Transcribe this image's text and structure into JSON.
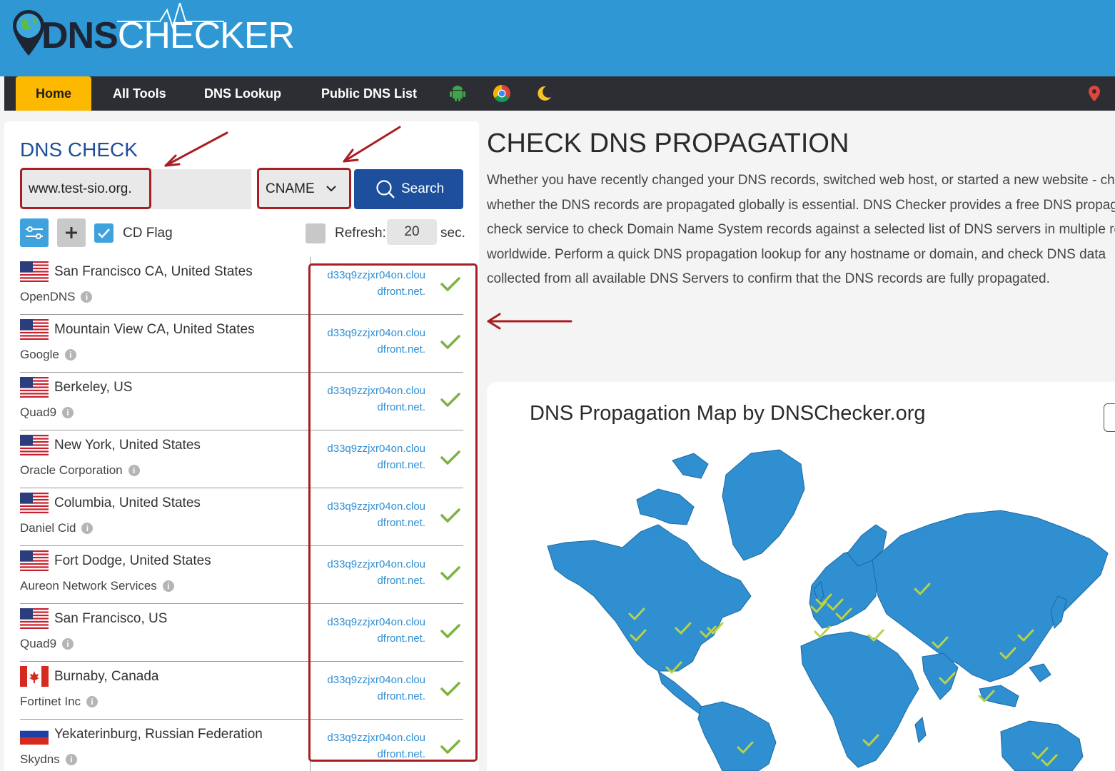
{
  "header": {
    "logo_text_a": "DNS",
    "logo_text_b": "CHECKER"
  },
  "nav": {
    "items": [
      {
        "label": "Home"
      },
      {
        "label": "All Tools"
      },
      {
        "label": "DNS Lookup"
      },
      {
        "label": "Public DNS List"
      }
    ],
    "icons": [
      "android-icon",
      "chrome-icon",
      "moon-icon",
      "location-pin-icon"
    ]
  },
  "dns_check": {
    "title": "DNS CHECK",
    "domain_value": "www.test-sio.org.",
    "record_type": "CNAME",
    "search_label": "Search",
    "cd_flag_label": "CD Flag",
    "cd_flag_checked": true,
    "refresh_label": "Refresh:",
    "refresh_value": "20",
    "refresh_unit": "sec.",
    "results": [
      {
        "location": "San Francisco CA, United States",
        "provider": "OpenDNS",
        "flag": "us",
        "result": [
          "d33q9zzjxr04on.clou",
          "dfront.net."
        ]
      },
      {
        "location": "Mountain View CA, United States",
        "provider": "Google",
        "flag": "us",
        "result": [
          "d33q9zzjxr04on.clou",
          "dfront.net."
        ]
      },
      {
        "location": "Berkeley, US",
        "provider": "Quad9",
        "flag": "us",
        "result": [
          "d33q9zzjxr04on.clou",
          "dfront.net."
        ]
      },
      {
        "location": "New York, United States",
        "provider": "Oracle Corporation",
        "flag": "us",
        "result": [
          "d33q9zzjxr04on.clou",
          "dfront.net."
        ]
      },
      {
        "location": "Columbia, United States",
        "provider": "Daniel Cid",
        "flag": "us",
        "result": [
          "d33q9zzjxr04on.clou",
          "dfront.net."
        ]
      },
      {
        "location": "Fort Dodge, United States",
        "provider": "Aureon Network Services",
        "flag": "us",
        "result": [
          "d33q9zzjxr04on.clou",
          "dfront.net."
        ]
      },
      {
        "location": "San Francisco, US",
        "provider": "Quad9",
        "flag": "us",
        "result": [
          "d33q9zzjxr04on.clou",
          "dfront.net."
        ]
      },
      {
        "location": "Burnaby, Canada",
        "provider": "Fortinet Inc",
        "flag": "ca",
        "result": [
          "d33q9zzjxr04on.clou",
          "dfront.net."
        ]
      },
      {
        "location": "Yekaterinburg, Russian Federation",
        "provider": "Skydns",
        "flag": "ru",
        "result": [
          "d33q9zzjxr04on.clou",
          "dfront.net."
        ]
      }
    ]
  },
  "main": {
    "title": "CHECK DNS PROPAGATION",
    "desc_lines": [
      "Whether you have recently changed your DNS records, switched web host, or started a new website - ch",
      "whether the DNS records are propagated globally is essential. DNS Checker provides a free DNS propag",
      "check service to check Domain Name System records against a selected list of DNS servers in multiple re",
      "worldwide. Perform a quick DNS propagation lookup for any hostname or domain, and check DNS data",
      "collected from all available DNS Servers to confirm that the DNS records are fully propagated."
    ]
  },
  "map": {
    "title": "DNS Propagation Map by DNSChecker.org",
    "land_color": "#2f8fd0",
    "check_color": "#b8d24a"
  },
  "colors": {
    "topbar": "#2e97d4",
    "nav_bg": "#2d2e33",
    "nav_active": "#fdb800",
    "accent_blue": "#1e4f9d",
    "annotation_red": "#a81e22",
    "check_green": "#7cb342"
  }
}
